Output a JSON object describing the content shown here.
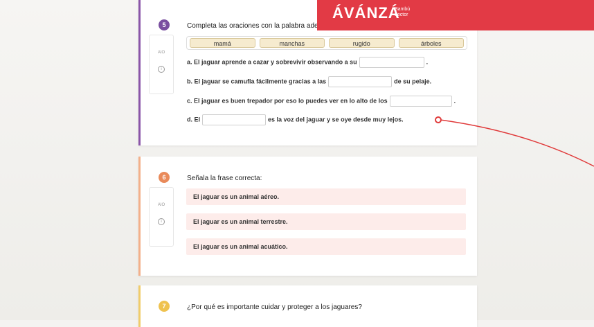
{
  "banner": {
    "logo": "ÁVÁNZÁ",
    "sub_line1": "Bambú",
    "sub_line2": "Lector",
    "color": "#e23a45"
  },
  "q5": {
    "number": "5",
    "color": "#7a4fa0",
    "points": "AIO",
    "prompt": "Completa las oraciones con la palabra ade",
    "words": [
      "mamá",
      "manchas",
      "rugido",
      "árboles"
    ],
    "sentences": [
      {
        "a": "a. El jaguar aprende a cazar y sobrevivir observando a su",
        "b": "."
      },
      {
        "a": "b. El jaguar se camufla fácilmente gracias a las",
        "b": "de su pelaje."
      },
      {
        "a": "c. El jaguar es buen trepador por eso lo puedes ver en lo alto de los",
        "b": "."
      },
      {
        "a": "d. El",
        "b": "es la voz del jaguar y se oye desde muy lejos."
      }
    ]
  },
  "q6": {
    "number": "6",
    "color": "#e98a5a",
    "points": "AIO",
    "prompt": "Señala la frase correcta:",
    "options": [
      "El jaguar es un animal aéreo.",
      "El jaguar es un animal terrestre.",
      "El jaguar es un animal acuático."
    ]
  },
  "q7": {
    "number": "7",
    "color": "#efc24f",
    "prompt": "¿Por qué es importante cuidar y proteger a los jaguares?"
  }
}
